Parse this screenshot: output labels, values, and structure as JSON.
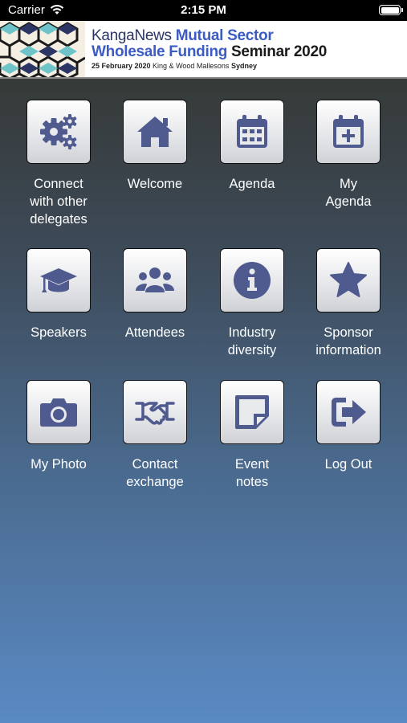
{
  "status_bar": {
    "carrier": "Carrier",
    "time": "2:15 PM"
  },
  "banner": {
    "brand": "KangaNews",
    "line1_rest": " Mutual Sector",
    "line2_blue": "Wholesale Funding",
    "line2_dark": " Seminar 2020",
    "date": "25 February 2020",
    "venue": " King & Wood Mallesons ",
    "city": "Sydney"
  },
  "tiles": [
    {
      "label": "Connect\nwith other\ndelegates",
      "icon": "gears-icon"
    },
    {
      "label": "Welcome",
      "icon": "home-icon"
    },
    {
      "label": "Agenda",
      "icon": "calendar-icon"
    },
    {
      "label": "My\nAgenda",
      "icon": "calendar-plus-icon"
    },
    {
      "label": "Speakers",
      "icon": "graduation-cap-icon"
    },
    {
      "label": "Attendees",
      "icon": "users-icon"
    },
    {
      "label": "Industry\ndiversity",
      "icon": "info-icon"
    },
    {
      "label": "Sponsor\ninformation",
      "icon": "star-icon"
    },
    {
      "label": "My Photo",
      "icon": "camera-icon"
    },
    {
      "label": "Contact\nexchange",
      "icon": "handshake-icon"
    },
    {
      "label": "Event\nnotes",
      "icon": "sticky-note-icon"
    },
    {
      "label": "Log Out",
      "icon": "sign-out-icon"
    }
  ],
  "colors": {
    "icon": "#4f5a8f",
    "accent_blue": "#3c5cc4"
  }
}
